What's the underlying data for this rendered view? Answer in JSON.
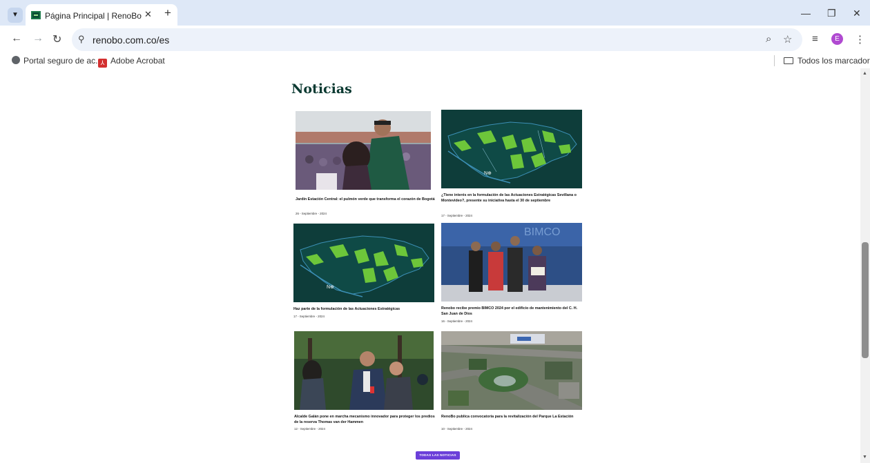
{
  "browser": {
    "tab_title": "Página Principal | RenoBo",
    "tab_close": "✕",
    "new_tab": "+",
    "url": "renobo.com.co/es",
    "avatar_letter": "E",
    "window_controls": {
      "minimize": "—",
      "restore": "❐",
      "close": "✕"
    }
  },
  "bookmarks": {
    "items": [
      {
        "label": "Portal seguro de ac...",
        "icon": "globe-icon"
      },
      {
        "label": "Adobe Acrobat",
        "icon": "pdf-icon"
      }
    ],
    "all_bookmarks": "Todos los marcadores"
  },
  "page": {
    "section_title": "Noticias",
    "button_all": "TODAS LAS NOTICIAS",
    "news": [
      {
        "title": "Jardín Estación Central: el pulmón verde que transforma el corazón de Bogotá",
        "date": "26 - Septiembre - 2024",
        "image": "ceremony-photo"
      },
      {
        "title": "¿Tiene interés en la formulación de las Actuaciones Estratégicas Sevillana o Montevideo?, presente su iniciativa hasta el 30 de septiembre",
        "date": "17 - Septiembre - 2024",
        "image": "city-map"
      },
      {
        "title": "Haz parte de la formulación de las Actuaciones Estratégicas",
        "date": "17 - Septiembre - 2024",
        "image": "city-map"
      },
      {
        "title": "Renobo recibe premio BIMCO 2024 por el edificio de mantenimiento del C. H. San Juan de Dios",
        "date": "16 - Septiembre - 2024",
        "image": "award-photo"
      },
      {
        "title": "Alcalde Galán pone en marcha mecanismo innovador para proteger los predios de la reserva Thomas van der Hammen",
        "date": "12 - Septiembre - 2024",
        "image": "press-photo"
      },
      {
        "title": "RenoBo publica convocatoria para la revitalización del Parque La Estación",
        "date": "10 - Septiembre - 2024",
        "image": "aerial-photo"
      }
    ]
  },
  "colors": {
    "brand_green": "#0c3a32",
    "button_purple": "#6b3fd9",
    "map_bg": "#0e3d3a",
    "map_green": "#6dc63a"
  }
}
